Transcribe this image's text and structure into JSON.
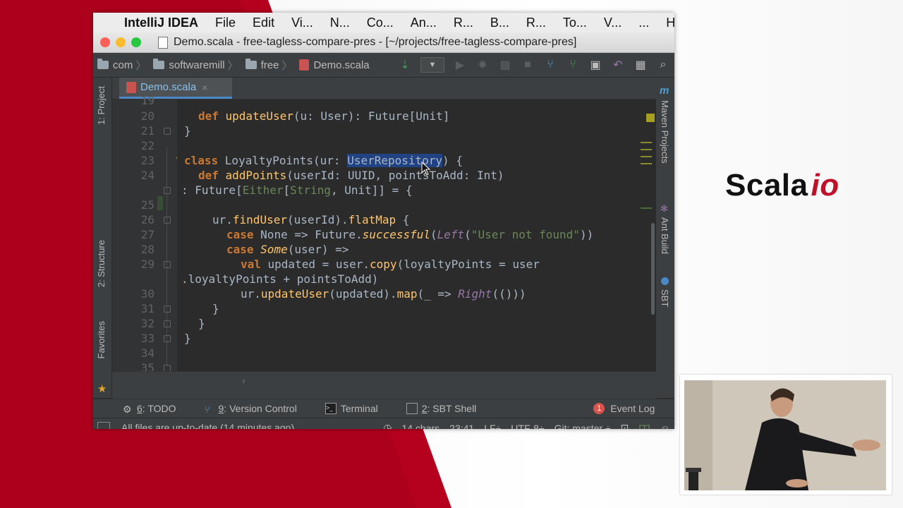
{
  "menubar": {
    "app": "IntelliJ IDEA",
    "items": [
      "File",
      "Edit",
      "Vi...",
      "N...",
      "Co...",
      "An...",
      "R...",
      "B...",
      "R...",
      "To...",
      "V...",
      "...",
      "H..."
    ]
  },
  "window": {
    "title": "Demo.scala - free-tagless-compare-pres - [~/projects/free-tagless-compare-pres]"
  },
  "breadcrumb": [
    "com",
    "softwaremill",
    "free",
    "Demo.scala"
  ],
  "tab": {
    "label": "Demo.scala",
    "close": "×"
  },
  "left_strip": [
    "1: Project",
    "2: Structure",
    "Favorites"
  ],
  "right_strip": [
    "Maven Projects",
    "Ant Build",
    "SBT"
  ],
  "editor": {
    "lines": [
      {
        "num": "19",
        "code": ""
      },
      {
        "num": "20",
        "code": "def updateUser(u: User): Future[Unit]"
      },
      {
        "num": "21",
        "code": "}"
      },
      {
        "num": "22",
        "code": ""
      },
      {
        "num": "23",
        "code": "class LoyaltyPoints(ur: UserRepository) {"
      },
      {
        "num": "24",
        "code": "def addPoints(userId: UUID, pointsToAdd: Int)"
      },
      {
        "num": "",
        "code": ": Future[Either[String, Unit]] = {"
      },
      {
        "num": "25",
        "code": ""
      },
      {
        "num": "26",
        "code": "ur.findUser(userId).flatMap {"
      },
      {
        "num": "27",
        "code": "case None => Future.successful(Left(\"User not found\"))"
      },
      {
        "num": "28",
        "code": "case Some(user) =>"
      },
      {
        "num": "29",
        "code": "val updated = user.copy(loyaltyPoints = user"
      },
      {
        "num": "",
        "code": ".loyaltyPoints + pointsToAdd)"
      },
      {
        "num": "30",
        "code": "ur.updateUser(updated).map(_ => Right(()))"
      },
      {
        "num": "31",
        "code": "}"
      },
      {
        "num": "32",
        "code": "}"
      },
      {
        "num": "33",
        "code": "}"
      },
      {
        "num": "34",
        "code": ""
      },
      {
        "num": "35",
        "code": "}"
      }
    ],
    "scroll_hint": "›"
  },
  "toolwindows": [
    {
      "num": "6",
      "label": ": TODO"
    },
    {
      "num": "9",
      "label": ": Version Control"
    },
    {
      "num": "",
      "label": "Terminal"
    },
    {
      "num": "2",
      "label": ": SBT Shell"
    }
  ],
  "event_log": {
    "count": "1",
    "label": "Event Log"
  },
  "status": {
    "message": "All files are up-to-date (14 minutes ago)",
    "chars": "14 chars",
    "position": "23:41",
    "line_sep": "LF÷",
    "encoding": "UTF-8÷",
    "vcs": "Git: master ÷",
    "mode": "[T]"
  },
  "logo": {
    "text": "Scala",
    "suffix": "io"
  },
  "colors": {
    "keyword": "#cc7832",
    "function": "#ffc66d",
    "string": "#6a8759",
    "italic_type": "#9876aa",
    "selection": "#214283",
    "brand_red": "#c0102a"
  }
}
